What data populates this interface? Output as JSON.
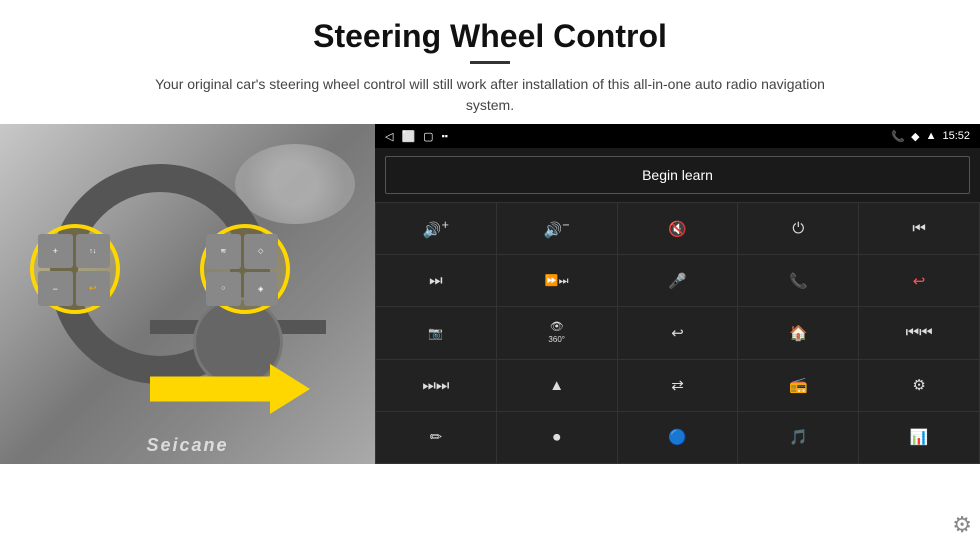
{
  "header": {
    "title": "Steering Wheel Control",
    "divider": true,
    "subtitle": "Your original car's steering wheel control will still work after installation of this all-in-one auto radio navigation system."
  },
  "status_bar": {
    "left_icons": [
      "◁",
      "⬜",
      "▢",
      "📶"
    ],
    "right_icons": [
      "📞",
      "◆",
      "WiFi"
    ],
    "time": "15:52"
  },
  "begin_learn": {
    "label": "Begin learn"
  },
  "controls": [
    {
      "icon": "🔊+",
      "symbol": "vol_up"
    },
    {
      "icon": "🔊-",
      "symbol": "vol_down"
    },
    {
      "icon": "🔇",
      "symbol": "mute"
    },
    {
      "icon": "⏻",
      "symbol": "power"
    },
    {
      "icon": "⏮",
      "symbol": "prev_track"
    },
    {
      "icon": "⏭",
      "symbol": "next"
    },
    {
      "icon": "⏭⏸",
      "symbol": "ff"
    },
    {
      "icon": "🎤",
      "symbol": "mic"
    },
    {
      "icon": "📞",
      "symbol": "phone"
    },
    {
      "icon": "↩",
      "symbol": "hangup"
    },
    {
      "icon": "📷",
      "symbol": "camera"
    },
    {
      "icon": "👁360",
      "symbol": "cam360"
    },
    {
      "icon": "↺",
      "symbol": "back"
    },
    {
      "icon": "🏠",
      "symbol": "home"
    },
    {
      "icon": "⏮⏮",
      "symbol": "rewind"
    },
    {
      "icon": "⏭⏭",
      "symbol": "ff2"
    },
    {
      "icon": "▲",
      "symbol": "nav"
    },
    {
      "icon": "⇄",
      "symbol": "switch"
    },
    {
      "icon": "📻",
      "symbol": "radio"
    },
    {
      "icon": "⚙",
      "symbol": "eq"
    },
    {
      "icon": "✏",
      "symbol": "edit"
    },
    {
      "icon": "⏺",
      "symbol": "record"
    },
    {
      "icon": "🔵",
      "symbol": "bluetooth"
    },
    {
      "icon": "🎵",
      "symbol": "music"
    },
    {
      "icon": "📊",
      "symbol": "equalizer"
    }
  ],
  "watermark": "Seicane",
  "gear_icon": "⚙"
}
